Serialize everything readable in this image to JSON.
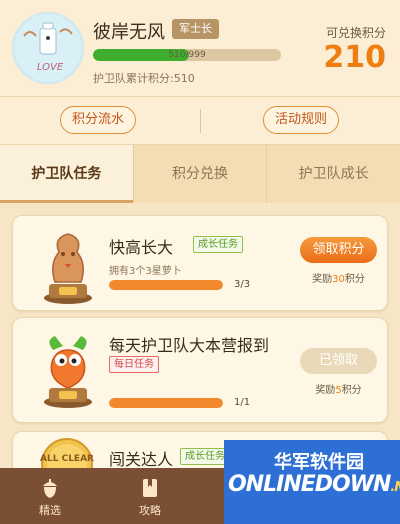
{
  "profile": {
    "name": "彼岸无风",
    "rank_badge": "军士长",
    "avatar_text": "LOVE",
    "xp_current": 510,
    "xp_max": 999,
    "xp_label": "510/999",
    "team_points_label": "护卫队累计积分:510",
    "redeemable_label": "可兑换积分",
    "redeemable_value": "210"
  },
  "actions": {
    "points_flow": "积分流水",
    "event_rules": "活动规则"
  },
  "tabs": [
    {
      "label": "护卫队任务",
      "active": true
    },
    {
      "label": "积分兑换",
      "active": false
    },
    {
      "label": "护卫队成长",
      "active": false
    }
  ],
  "tasks": [
    {
      "title": "快高长大",
      "tag": "成长任务",
      "desc": "拥有3个3星萝卜",
      "progress": 1.0,
      "progress_label": "3/3",
      "button": "领取积分",
      "reward_prefix": "奖励",
      "reward_points": "30",
      "reward_suffix": "积分"
    },
    {
      "title": "每天护卫队大本营报到",
      "tag": "每日任务",
      "progress": 1.0,
      "progress_label": "1/1",
      "button": "已领取",
      "reward_prefix": "奖励",
      "reward_points": "5",
      "reward_suffix": "积分"
    },
    {
      "title": "闯关达人",
      "tag": "成长任务",
      "trophy_text": "ALL CLEAR"
    }
  ],
  "nav": [
    {
      "label": "精选",
      "icon": "acorn-icon"
    },
    {
      "label": "攻略",
      "icon": "bookmark-icon"
    }
  ],
  "watermark": {
    "cn": "华军软件园",
    "en": "ONLINEDOWN",
    "suffix": ".NET"
  },
  "colors": {
    "accent_orange": "#ee7d12",
    "progress_green": "#3fae2f",
    "nav_brown": "#7a4f33",
    "watermark_blue": "#2e6fd6"
  }
}
